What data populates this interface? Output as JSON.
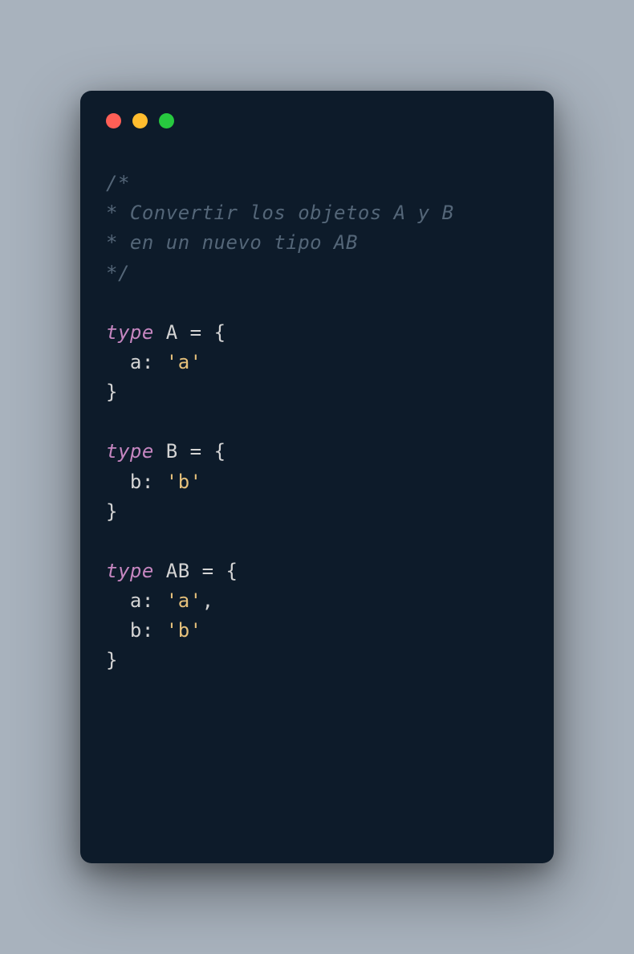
{
  "comment": {
    "line1": "/*",
    "line2": "* Convertir los objetos A y B",
    "line3": "* en un nuevo tipo AB",
    "line4": "*/"
  },
  "typeA": {
    "keyword": "type",
    "name": " A ",
    "equals": "= ",
    "openBrace": "{",
    "propIndent": "  ",
    "propName": "a",
    "colon": ": ",
    "propValue": "'a'",
    "closeBrace": "}"
  },
  "typeB": {
    "keyword": "type",
    "name": " B ",
    "equals": "= ",
    "openBrace": "{",
    "propIndent": "  ",
    "propName": "b",
    "colon": ": ",
    "propValue": "'b'",
    "closeBrace": "}"
  },
  "typeAB": {
    "keyword": "type",
    "name": " AB ",
    "equals": "= ",
    "openBrace": "{",
    "propIndent": "  ",
    "prop1Name": "a",
    "prop1Value": "'a'",
    "comma": ",",
    "prop2Name": "b",
    "prop2Value": "'b'",
    "colon": ": ",
    "closeBrace": "}"
  }
}
